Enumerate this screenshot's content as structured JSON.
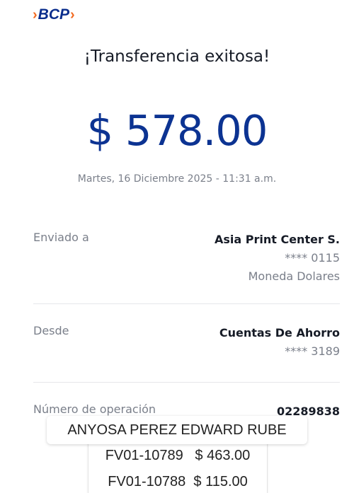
{
  "brand": {
    "name": "BCP"
  },
  "receipt": {
    "title": "¡Transferencia exitosa!",
    "amount": "$ 578.00",
    "datetime": "Martes, 16 Diciembre 2025 - 11:31 a.m."
  },
  "details": [
    {
      "label": "Enviado a",
      "value": "Asia Print Center S.",
      "sub1": "**** 0115",
      "sub2": "Moneda Dolares"
    },
    {
      "label": "Desde",
      "value": "Cuentas De Ahorro",
      "sub1": "**** 3189"
    },
    {
      "label": "Número de operación",
      "value": "02289838"
    }
  ],
  "overlay": {
    "name": "ANYOSA PEREZ EDWARD RUBE",
    "lines": [
      "FV01-10789   $ 463.00",
      "FV01-10788  $ 115.00"
    ]
  },
  "colors": {
    "brand_blue": "#0a2d8c",
    "brand_orange": "#f26a21",
    "amount_blue": "#0c3392"
  }
}
